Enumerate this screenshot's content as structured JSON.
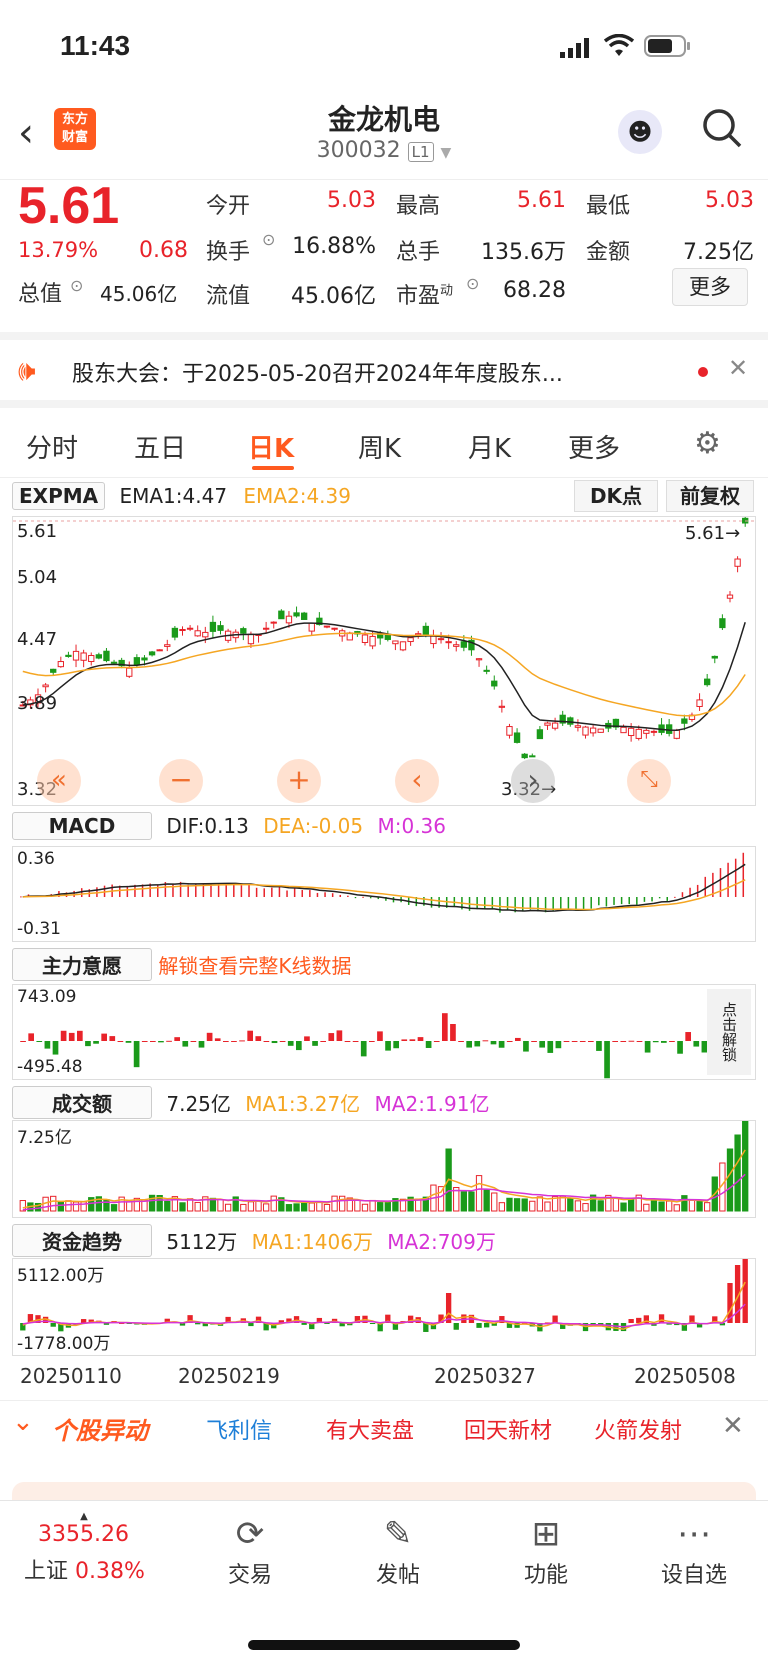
{
  "status_bar": {
    "time": "11:43"
  },
  "header": {
    "title": "金龙机电",
    "code": "300032",
    "level": "L1",
    "logo_line1": "东方",
    "logo_line2": "财富"
  },
  "quote": {
    "price": "5.61",
    "pct": "13.79%",
    "change": "0.68",
    "open_label": "今开",
    "open": "5.03",
    "high_label": "最高",
    "high": "5.61",
    "low_label": "最低",
    "low": "5.03",
    "turnover_label": "换手",
    "turnover": "16.88%",
    "volume_label": "总手",
    "volume": "135.6万",
    "amount_label": "金额",
    "amount": "7.25亿",
    "mcap_label": "总值",
    "mcap": "45.06亿",
    "float_label": "流值",
    "float": "45.06亿",
    "pe_label": "市盈",
    "pe_sup": "动",
    "pe": "68.28",
    "more_label": "更多"
  },
  "notice": {
    "text": "股东大会：于2025-05-20召开2024年年度股东..."
  },
  "tabs": {
    "t1": "分时",
    "t2": "五日",
    "t3": "日K",
    "t4": "周K",
    "t5": "月K",
    "t6": "更多"
  },
  "kline": {
    "indicator": "EXPMA",
    "ema1": "EMA1:4.47",
    "ema2": "EMA2:4.39",
    "dk_label": "DK点",
    "adj_label": "前复权",
    "y1": "5.61",
    "y2": "5.04",
    "y3": "4.47",
    "y4": "3.89",
    "y5": "3.32",
    "high_mark": "5.61",
    "low_mark": "3.32"
  },
  "macd": {
    "name": "MACD",
    "dif": "DIF:0.13",
    "dea": "DEA:-0.05",
    "m": "M:0.36",
    "ymax": "0.36",
    "ymin": "-0.31"
  },
  "main_force": {
    "name": "主力意愿",
    "unlock": "解锁查看完整K线数据",
    "ymax": "743.09",
    "ymin": "-495.48",
    "side": "点击解锁"
  },
  "turnover_panel": {
    "name": "成交额",
    "value": "7.25亿",
    "ma1": "MA1:3.27亿",
    "ma2": "MA2:1.91亿",
    "ymax": "7.25亿"
  },
  "fund_panel": {
    "name": "资金趋势",
    "value": "5112万",
    "ma1": "MA1:1406万",
    "ma2": "MA2:709万",
    "ymax": "5112.00万",
    "ymin": "-1778.00万"
  },
  "dates": {
    "d1": "20250110",
    "d2": "20250219",
    "d3": "20250327",
    "d4": "20250508"
  },
  "movers": {
    "title": "个股异动",
    "m1": "飞利信",
    "m2": "有大卖盘",
    "m3": "回天新材",
    "m4": "火箭发射"
  },
  "nav": {
    "index_value": "3355.26",
    "index_name": "上证",
    "index_pct": "0.38%",
    "trade": "交易",
    "post": "发帖",
    "func": "功能",
    "watch": "设自选"
  },
  "colors": {
    "up": "#e8232a",
    "down": "#1a9a1a",
    "ema2": "#f5a623",
    "ma2": "#d633d6",
    "accent": "#ff5a1f"
  }
}
